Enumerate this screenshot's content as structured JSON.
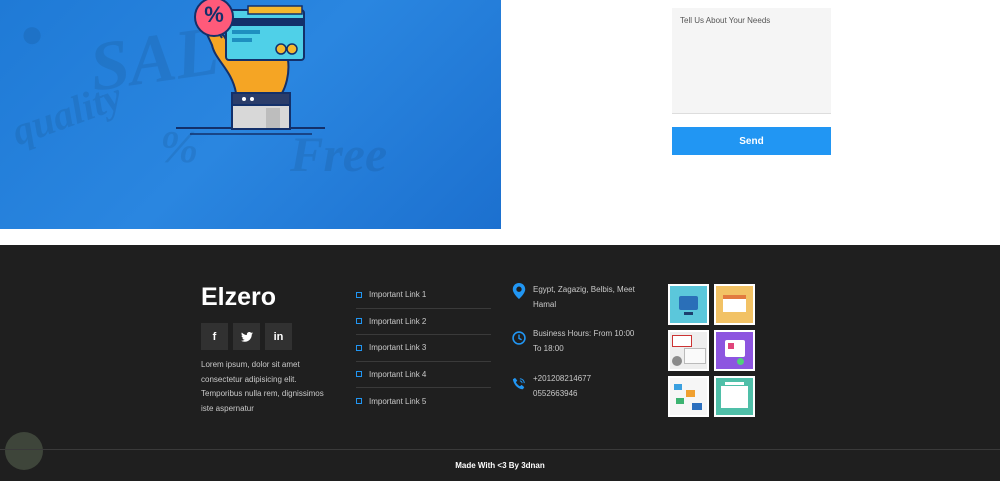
{
  "hero": {
    "illustration_icon": "credit-card-hand-icon",
    "badge_symbol": "%"
  },
  "contact": {
    "textarea_placeholder": "Tell Us About Your Needs",
    "send_label": "Send"
  },
  "footer": {
    "brand": "Elzero",
    "social": [
      {
        "icon": "facebook-icon",
        "glyph": "f"
      },
      {
        "icon": "twitter-icon",
        "glyph": "t"
      },
      {
        "icon": "linkedin-icon",
        "glyph": "in"
      }
    ],
    "about": "Lorem ipsum, dolor sit amet consectetur adipisicing elit. Temporibus nulla rem, dignissimos iste aspernatur",
    "links": [
      "Important Link 1",
      "Important Link 2",
      "Important Link 3",
      "Important Link 4",
      "Important Link 5"
    ],
    "info": {
      "address": "Egypt, Zagazig, Belbis, Meet Hamal",
      "hours": "Business Hours: From 10:00 To 18:00",
      "phones": "+201208214677\n0552663946"
    },
    "copyright": "Made With <3 By 3dnan"
  },
  "colors": {
    "accent": "#2196f3",
    "footer_bg": "#1f1f1f",
    "hero_blue": "#1f7ad6"
  }
}
